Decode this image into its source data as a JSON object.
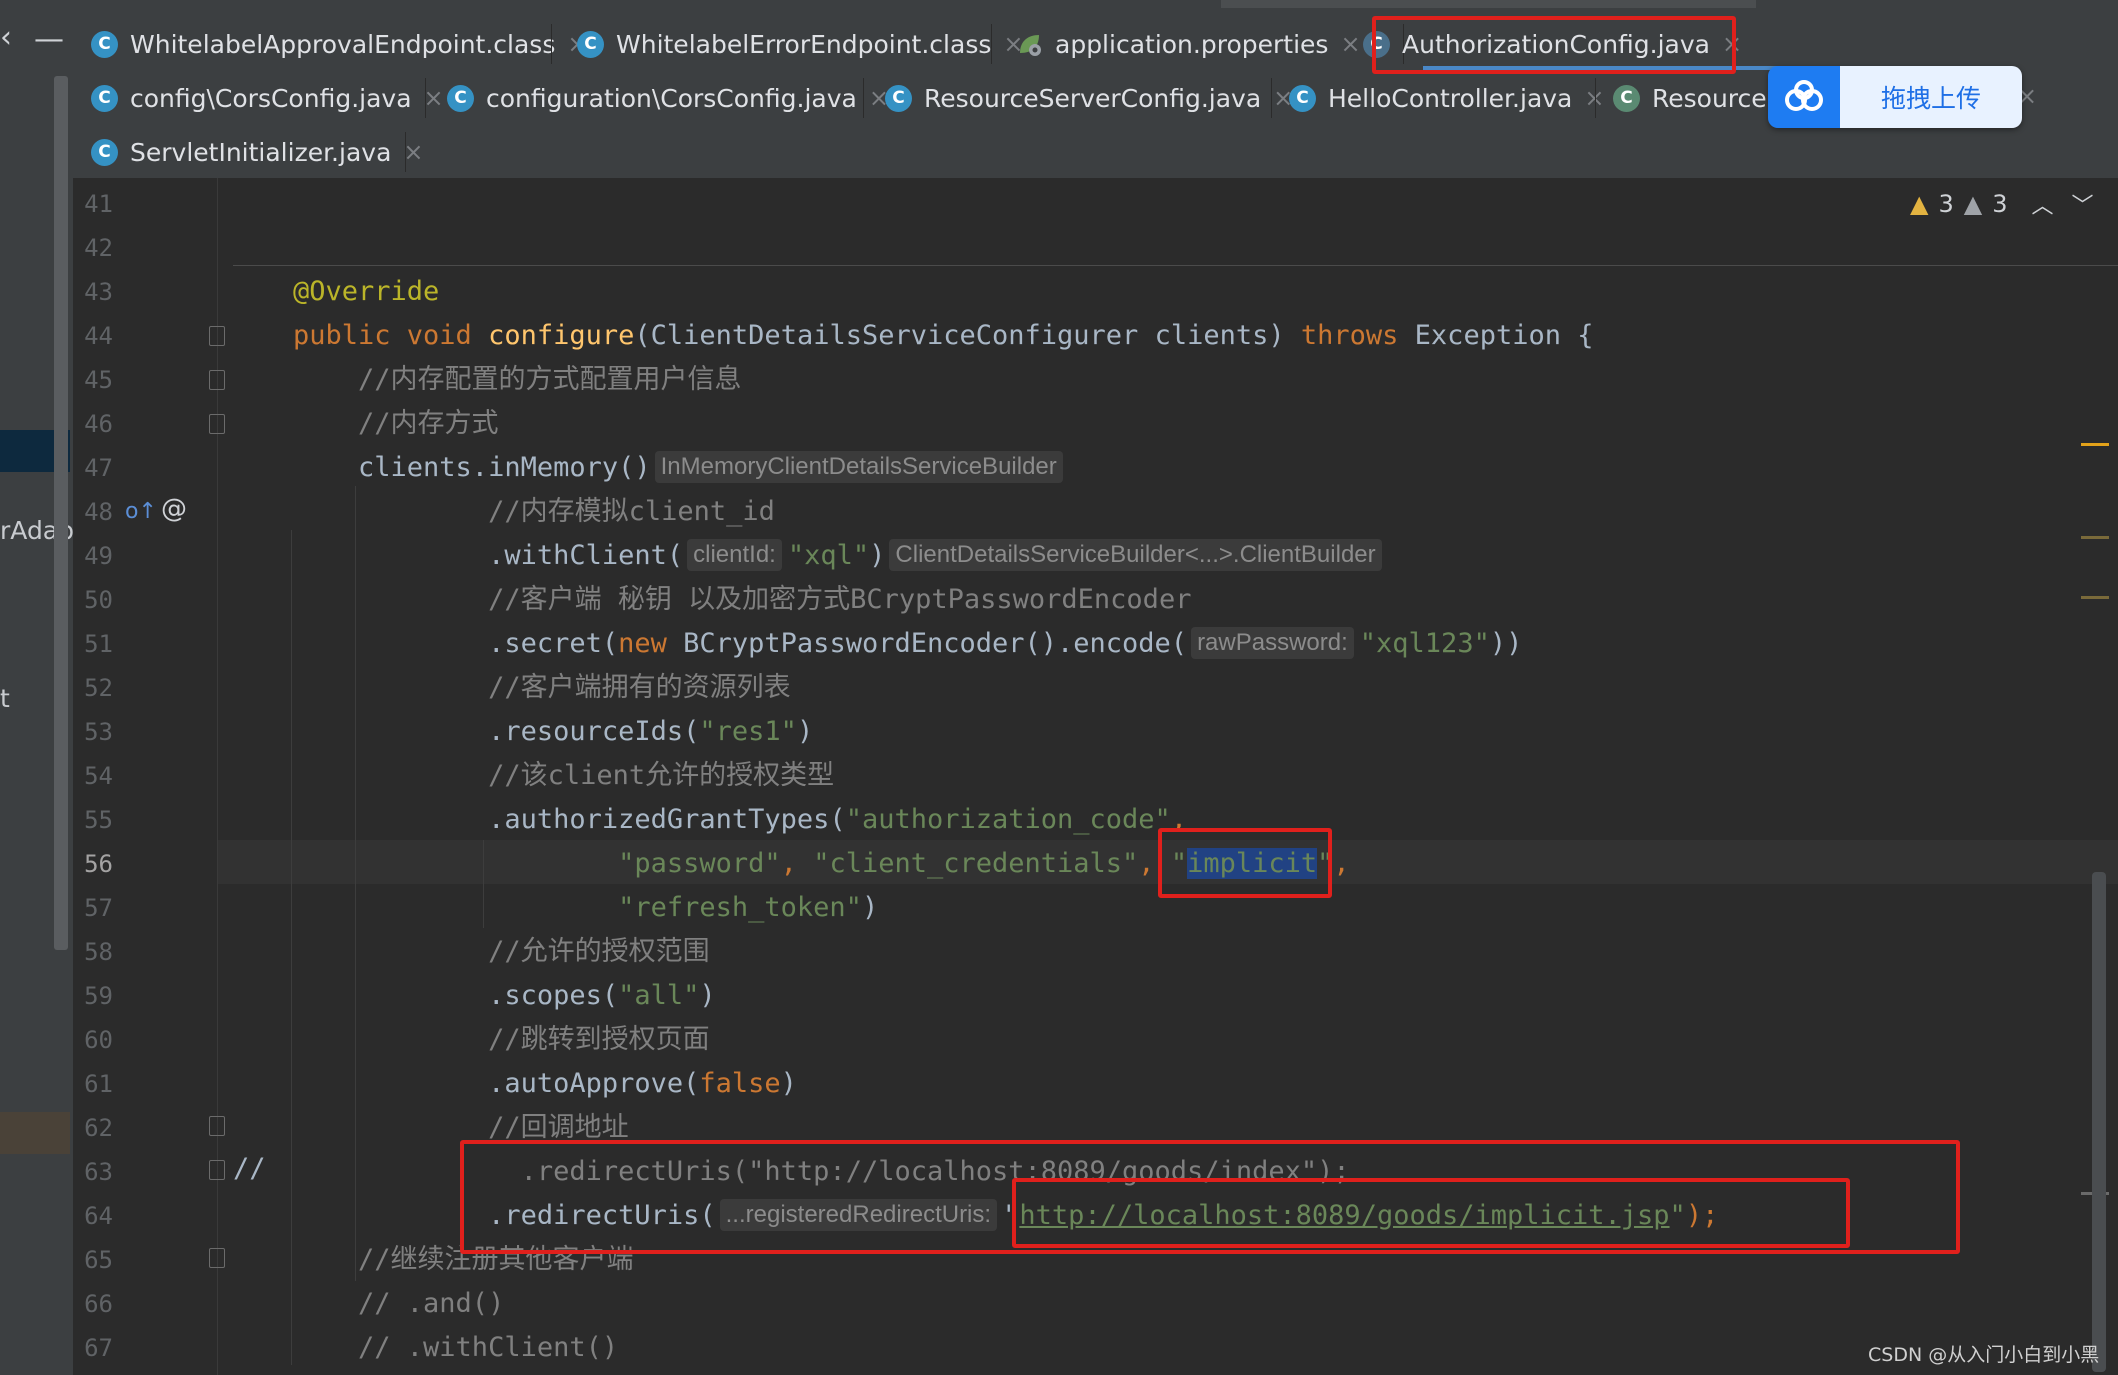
{
  "tabs": {
    "row1": [
      {
        "label": "WhitelabelApprovalEndpoint.class",
        "icon": "class-icon"
      },
      {
        "label": "WhitelabelErrorEndpoint.class",
        "icon": "class-icon"
      },
      {
        "label": "application.properties",
        "icon": "spring-config-icon"
      },
      {
        "label": "AuthorizationConfig.java",
        "icon": "class-icon",
        "active": true
      }
    ],
    "row2": [
      {
        "label": "config\\CorsConfig.java",
        "icon": "class-icon"
      },
      {
        "label": "configuration\\CorsConfig.java",
        "icon": "class-icon"
      },
      {
        "label": "ResourceServerConfig.java",
        "icon": "class-icon"
      },
      {
        "label": "HelloController.java",
        "icon": "class-icon"
      },
      {
        "label": "ResourceS",
        "icon": "spring-class-icon"
      }
    ],
    "row3": [
      {
        "label": "ServletInitializer.java",
        "icon": "class-icon"
      }
    ],
    "close_glyph": "×",
    "class_glyph": "C"
  },
  "upload_widget": {
    "label": "拖拽上传",
    "icon": "baidu-cloud-icon"
  },
  "left_panel": {
    "fragment": "rAdapt",
    "fragment2": "t"
  },
  "inspections": {
    "warnings": "3",
    "weak_warnings": "3"
  },
  "editor": {
    "lines": [
      {
        "n": "41"
      },
      {
        "n": "42"
      },
      {
        "n": "43",
        "segs": [
          {
            "t": "@Override",
            "c": "ann"
          }
        ]
      },
      {
        "n": "44",
        "segs": [
          {
            "t": "public void ",
            "c": "kw"
          },
          {
            "t": "configure",
            "c": "fn"
          },
          {
            "t": "(ClientDetailsServiceConfigurer clients) "
          },
          {
            "t": "throws ",
            "c": "kw"
          },
          {
            "t": "Exception {"
          }
        ]
      },
      {
        "n": "45",
        "segs": [
          {
            "t": "    //内存配置的方式配置用户信息",
            "c": "cm"
          }
        ]
      },
      {
        "n": "46",
        "segs": [
          {
            "t": "    //内存方式",
            "c": "cm"
          }
        ]
      },
      {
        "n": "47",
        "segs": [
          {
            "t": "    clients.inMemory()"
          },
          {
            "t": "InMemoryClientDetailsServiceBuilder",
            "c": "hint"
          }
        ]
      },
      {
        "n": "48",
        "segs": [
          {
            "t": "            //内存模拟client_id",
            "c": "cm"
          }
        ]
      },
      {
        "n": "49",
        "segs": [
          {
            "t": "            .withClient("
          },
          {
            "t": "clientId:",
            "c": "hint"
          },
          {
            "t": "\"xql\"",
            "c": "str"
          },
          {
            "t": ")"
          },
          {
            "t": "ClientDetailsServiceBuilder<...>.ClientBuilder",
            "c": "hint"
          }
        ]
      },
      {
        "n": "50",
        "segs": [
          {
            "t": "            //客户端 秘钥 以及加密方式BCryptPasswordEncoder",
            "c": "cm"
          }
        ]
      },
      {
        "n": "51",
        "segs": [
          {
            "t": "            .secret("
          },
          {
            "t": "new ",
            "c": "kw"
          },
          {
            "t": "BCryptPasswordEncoder().encode("
          },
          {
            "t": "rawPassword:",
            "c": "hint"
          },
          {
            "t": "\"xql123\"",
            "c": "str"
          },
          {
            "t": "))"
          }
        ]
      },
      {
        "n": "52",
        "segs": [
          {
            "t": "            //客户端拥有的资源列表",
            "c": "cm"
          }
        ]
      },
      {
        "n": "53",
        "segs": [
          {
            "t": "            .resourceIds("
          },
          {
            "t": "\"res1\"",
            "c": "str"
          },
          {
            "t": ")"
          }
        ]
      },
      {
        "n": "54",
        "segs": [
          {
            "t": "            //该client允许的授权类型",
            "c": "cm"
          }
        ]
      },
      {
        "n": "55",
        "segs": [
          {
            "t": "            .authorizedGrantTypes("
          },
          {
            "t": "\"authorization_code\"",
            "c": "str"
          },
          {
            "t": ",",
            "c": "kw"
          }
        ]
      },
      {
        "n": "56",
        "segs": [
          {
            "t": "                    \"password\"",
            "c": "str"
          },
          {
            "t": ", ",
            "c": "kw"
          },
          {
            "t": "\"client_credentials\"",
            "c": "str"
          },
          {
            "t": ", ",
            "c": "kw"
          },
          {
            "t": "\"",
            "c": "str"
          },
          {
            "t": "implicit",
            "c": "str sel"
          },
          {
            "t": "\"",
            "c": "str"
          },
          {
            "t": ",",
            "c": "kw"
          }
        ]
      },
      {
        "n": "57",
        "segs": [
          {
            "t": "                    \"refresh_token\"",
            "c": "str"
          },
          {
            "t": ")"
          }
        ]
      },
      {
        "n": "58",
        "segs": [
          {
            "t": "            //允许的授权范围",
            "c": "cm"
          }
        ]
      },
      {
        "n": "59",
        "segs": [
          {
            "t": "            .scopes("
          },
          {
            "t": "\"all\"",
            "c": "str"
          },
          {
            "t": ")"
          }
        ]
      },
      {
        "n": "60",
        "segs": [
          {
            "t": "            //跳转到授权页面",
            "c": "cm"
          }
        ]
      },
      {
        "n": "61",
        "segs": [
          {
            "t": "            .autoApprove("
          },
          {
            "t": "false",
            "c": "kw"
          },
          {
            "t": ")"
          }
        ]
      },
      {
        "n": "62",
        "segs": [
          {
            "t": "            //回调地址",
            "c": "cm"
          }
        ]
      },
      {
        "n": "63",
        "segs": [
          {
            "t": "              .redirectUris(",
            "c": "cm"
          },
          {
            "t": "\"http://localhost:8089/goods/index\"",
            "c": "cm"
          },
          {
            "t": ");",
            "c": "cm"
          }
        ]
      },
      {
        "n": "64",
        "segs": [
          {
            "t": "            .redirectUris("
          },
          {
            "t": "...registeredRedirectUris:",
            "c": "hint"
          },
          {
            "t": "\""
          },
          {
            "t": "http://localhost:8089/goods/implicit.jsp",
            "c": "url"
          },
          {
            "t": "\"",
            "c": "str"
          },
          {
            "t": ");",
            "c": "kw"
          }
        ]
      },
      {
        "n": "65",
        "segs": [
          {
            "t": "    //继续注册其他客户端",
            "c": "cm"
          }
        ]
      },
      {
        "n": "66",
        "segs": [
          {
            "t": "    // .and()",
            "c": "cm"
          }
        ]
      },
      {
        "n": "67",
        "segs": [
          {
            "t": "    // .withClient()",
            "c": "cm"
          }
        ]
      }
    ],
    "current_line": "56",
    "gutter_comment": "//"
  },
  "watermark": "CSDN @从入门小白到小黑"
}
